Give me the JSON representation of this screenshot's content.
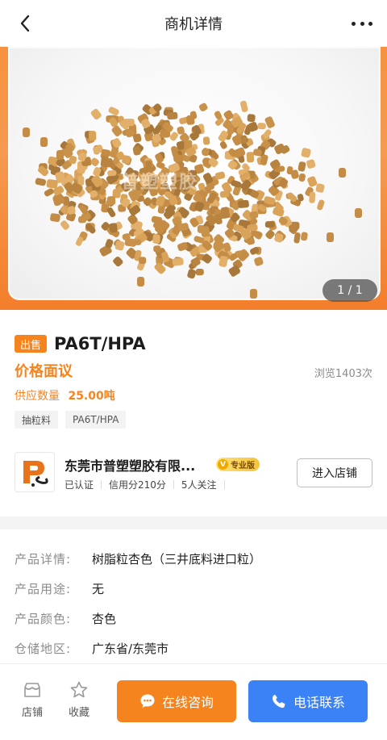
{
  "header": {
    "title": "商机详情"
  },
  "gallery": {
    "watermark": "普塑塑胶",
    "counter": "1 / 1"
  },
  "product": {
    "tag": "出售",
    "name": "PA6T/HPA",
    "price": "价格面议",
    "views": "浏览1403次",
    "supply_label": "供应数量",
    "supply_value": "25.00吨",
    "chips": [
      "抽粒料",
      "PA6T/HPA"
    ]
  },
  "store": {
    "name": "东莞市普塑塑胶有限...",
    "badge": "专业版",
    "badge_icon": "V",
    "verified": "已认证",
    "credit": "信用分210分",
    "followers": "5人关注",
    "enter_label": "进入店铺"
  },
  "details": [
    {
      "key": "产品详情:",
      "value": "树脂粒杏色（三井底料进口粒）"
    },
    {
      "key": "产品用途:",
      "value": "无"
    },
    {
      "key": "产品颜色:",
      "value": "杏色"
    },
    {
      "key": "仓储地区:",
      "value": "广东省/东莞市"
    }
  ],
  "bottom": {
    "shop_label": "店铺",
    "fav_label": "收藏",
    "consult_label": "在线咨询",
    "call_label": "电话联系"
  },
  "colors": {
    "accent": "#f5841f",
    "blue": "#3b82f6"
  }
}
